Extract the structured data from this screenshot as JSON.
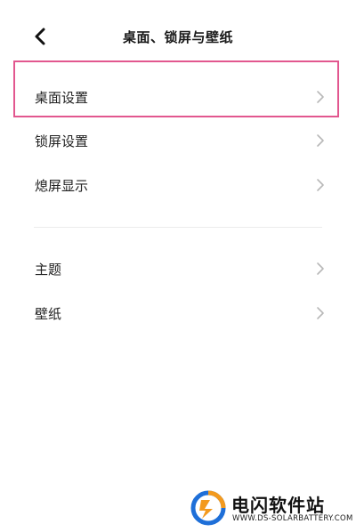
{
  "header": {
    "title": "桌面、锁屏与壁纸",
    "back_icon": "back-arrow-icon"
  },
  "group1": [
    {
      "label": "桌面设置",
      "icon": "chevron-right-icon",
      "highlighted": true
    },
    {
      "label": "锁屏设置",
      "icon": "chevron-right-icon"
    },
    {
      "label": "熄屏显示",
      "icon": "chevron-right-icon"
    }
  ],
  "group2": [
    {
      "label": "主题",
      "icon": "chevron-right-icon"
    },
    {
      "label": "壁纸",
      "icon": "chevron-right-icon"
    }
  ],
  "watermark": {
    "title": "电闪软件站",
    "url": "WWW.DS-SOLARBATTERY.COM"
  },
  "colors": {
    "highlight_border": "#e2578f",
    "chevron": "#b8b8b8",
    "divider": "#ececec",
    "logo_blue": "#1e6fd8",
    "logo_orange": "#f39a1e"
  }
}
